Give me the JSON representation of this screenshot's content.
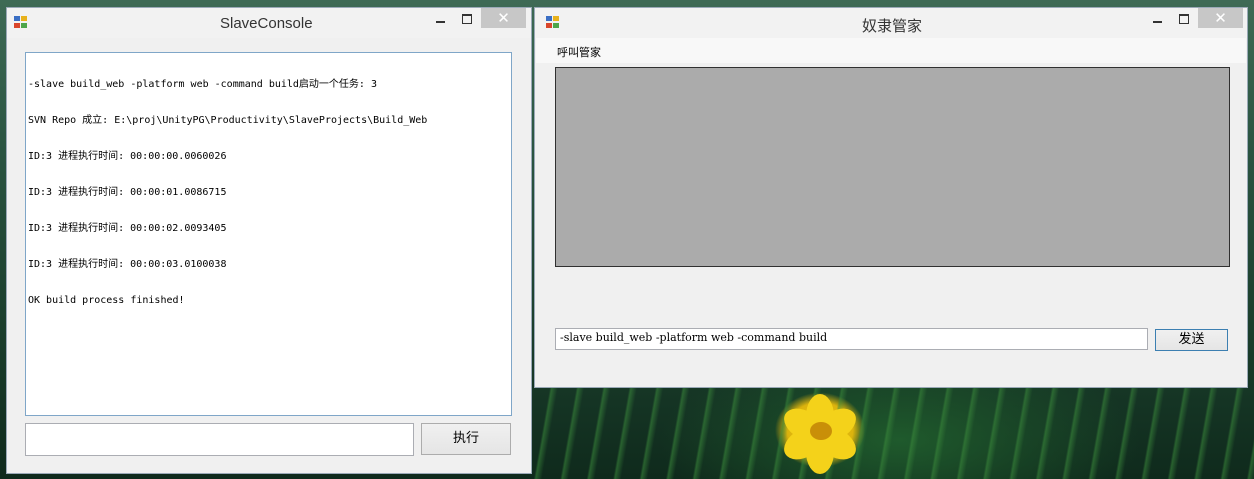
{
  "left_window": {
    "title": "SlaveConsole",
    "log_lines": [
      "-slave build_web -platform web -command build启动一个任务: 3",
      "SVN Repo 成立: E:\\proj\\UnityPG\\Productivity\\SlaveProjects\\Build_Web",
      "ID:3 进程执行时间: 00:00:00.0060026",
      "ID:3 进程执行时间: 00:00:01.0086715",
      "ID:3 进程执行时间: 00:00:02.0093405",
      "ID:3 进程执行时间: 00:00:03.0100038",
      "OK build process finished!"
    ],
    "command_input_value": "",
    "execute_label": "执行"
  },
  "right_window": {
    "title": "奴隶管家",
    "menu_item": "呼叫管家",
    "command_input_value": "-slave build_web -platform web -command build",
    "send_label": "发送"
  },
  "window_controls": {
    "close_glyph": "✕"
  },
  "colors": {
    "gray_panel": "#ababab",
    "window_bg": "#f0f0f0",
    "textarea_border": "#7fa6c8",
    "flower_yellow": "#f4d21a"
  },
  "icons": [
    "app-window-icon",
    "minimize-icon",
    "maximize-icon",
    "close-icon"
  ]
}
